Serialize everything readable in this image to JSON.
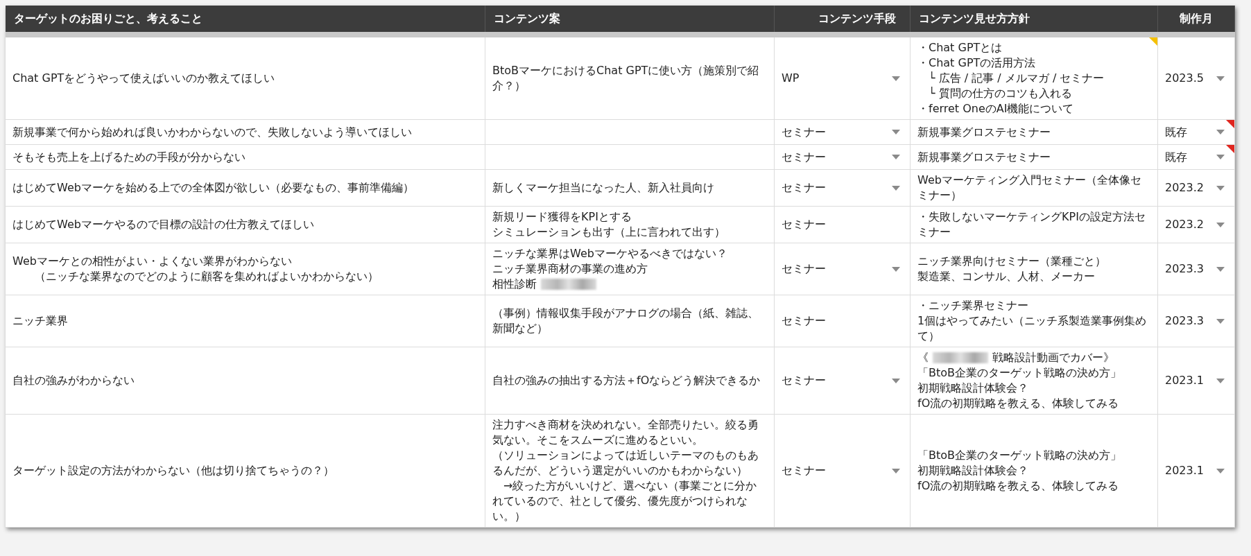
{
  "table": {
    "columns": [
      "ターゲットのお困りごと、考えること",
      "コンテンツ案",
      "コンテンツ手段",
      "コンテンツ見せ方方針",
      "制作月"
    ],
    "rows": [
      {
        "concern": [
          "Chat GPTをどうやって使えばいいのか教えてほしい"
        ],
        "idea": [
          "BtoBマーケにおけるChat GPTに使い方（施策別で紹介？）"
        ],
        "method": {
          "text": "WP",
          "dropdown": true
        },
        "policy": {
          "lines": [
            "・Chat GPTとは",
            "・Chat GPTの活用方法",
            "　└ 広告 / 記事 / メルマガ / セミナー",
            "　└ 質問の仕方のコツも入れる",
            "・ferret OneのAI機能について"
          ],
          "color": "#f5c000"
        },
        "month": {
          "text": "2023.5",
          "dropdown": true
        }
      },
      {
        "concern": [
          "新規事業で何から始めれば良いかわからないので、失敗しないよう導いてほしい"
        ],
        "idea": [],
        "method": {
          "text": "セミナー",
          "dropdown": true
        },
        "policy": {
          "lines": [
            "新規事業グロステセミナー"
          ]
        },
        "month": {
          "text": "既存",
          "dropdown": true,
          "color": "#e0261f"
        }
      },
      {
        "concern": [
          "そもそも売上を上げるための手段が分からない"
        ],
        "idea": [],
        "method": {
          "text": "セミナー",
          "dropdown": true
        },
        "policy": {
          "lines": [
            "新規事業グロステセミナー"
          ]
        },
        "month": {
          "text": "既存",
          "dropdown": true,
          "color": "#e0261f"
        }
      },
      {
        "concern": [
          "はじめてWebマーケを始める上での全体図が欲しい（必要なもの、事前準備編）"
        ],
        "idea": [
          "新しくマーケ担当になった人、新入社員向け"
        ],
        "method": {
          "text": "セミナー",
          "dropdown": true
        },
        "policy": {
          "lines": [
            "Webマーケティング入門セミナー（全体像セミナー）"
          ]
        },
        "month": {
          "text": "2023.2",
          "dropdown": true
        }
      },
      {
        "concern": [
          "はじめてWebマーケやるので目標の設計の仕方教えてほしい"
        ],
        "idea": [
          "新規リード獲得をKPIとする",
          "シミュレーションも出す（上に言われて出す）"
        ],
        "method": {
          "text": "セミナー",
          "dropdown": false
        },
        "policy": {
          "lines": [
            "・失敗しないマーケティングKPIの設定方法セミナー"
          ]
        },
        "month": {
          "text": "2023.2",
          "dropdown": true
        }
      },
      {
        "concern": [
          "Webマーケとの相性がよい・よくない業界がわからない",
          "　　（ニッチな業界なのでどのように顧客を集めればよいかわからない）"
        ],
        "idea": [
          "ニッチな業界はWebマーケやるべきではない？",
          "ニッチ業界商材の事業の進め方",
          {
            "kind": "redacted",
            "before": "相性診断"
          }
        ],
        "method": {
          "text": "セミナー",
          "dropdown": true
        },
        "policy": {
          "lines": [
            "ニッチ業界向けセミナー（業種ごと）",
            "製造業、コンサル、人材、メーカー"
          ]
        },
        "month": {
          "text": "2023.3",
          "dropdown": true
        }
      },
      {
        "concern": [
          "ニッチ業界"
        ],
        "idea": [
          "（事例）情報収集手段がアナログの場合（紙、雑誌、新聞など）"
        ],
        "method": {
          "text": "セミナー",
          "dropdown": false
        },
        "policy": {
          "lines": [
            "・ニッチ業界セミナー",
            "1個はやってみたい（ニッチ系製造業事例集めて）"
          ]
        },
        "month": {
          "text": "2023.3",
          "dropdown": true
        }
      },
      {
        "concern": [
          "自社の強みがわからない"
        ],
        "idea": [
          "自社の強みの抽出する方法＋fOならどう解決できるか"
        ],
        "method": {
          "text": "セミナー",
          "dropdown": true
        },
        "policy": {
          "lines": [
            {
              "kind": "redacted",
              "before": "《",
              "after": "戦略設計動画でカバー》"
            },
            "「BtoB企業のターゲット戦略の決め方」",
            "初期戦略設計体験会？",
            "fO流の初期戦略を教える、体験してみる"
          ]
        },
        "month": {
          "text": "2023.1",
          "dropdown": true
        }
      },
      {
        "concern": [
          "ターゲット設定の方法がわからない（他は切り捨てちゃうの？）"
        ],
        "idea": [
          "注力すべき商材を決めれない。全部売りたい。絞る勇気ない。そこをスムーズに進めるといい。",
          "（ソリューションによっては近しいテーマのものもあるんだが、どういう選定がいいのかもわからない）",
          "　→絞った方がいいけど、選べない（事業ごとに分かれているので、社として優劣、優先度がつけられない。）"
        ],
        "method": {
          "text": "セミナー",
          "dropdown": true
        },
        "policy": {
          "lines": [
            "「BtoB企業のターゲット戦略の決め方」",
            "初期戦略設計体験会？",
            "fO流の初期戦略を教える、体験してみる"
          ]
        },
        "month": {
          "text": "2023.1",
          "dropdown": true
        }
      }
    ]
  }
}
